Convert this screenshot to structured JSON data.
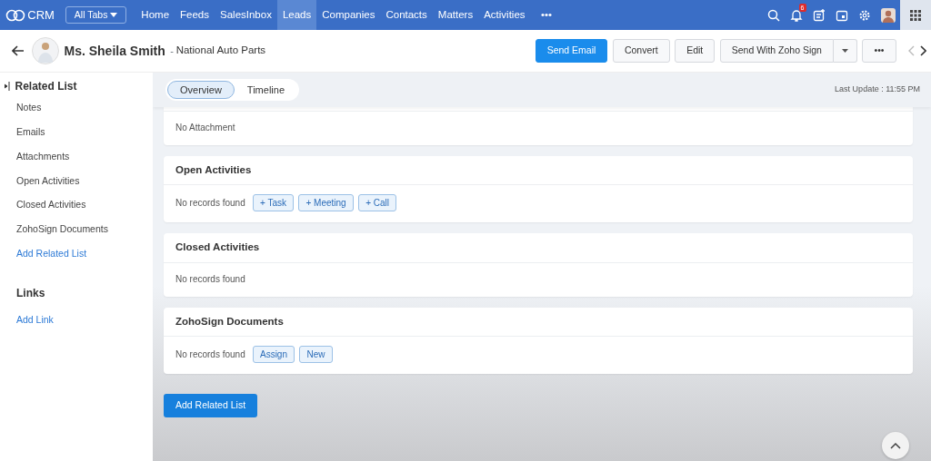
{
  "topbar": {
    "logo": "CRM",
    "all_tabs": "All Tabs",
    "tabs": [
      {
        "label": "Home",
        "selected": false
      },
      {
        "label": "Feeds",
        "selected": false
      },
      {
        "label": "SalesInbox",
        "selected": false
      },
      {
        "label": "Leads",
        "selected": true
      },
      {
        "label": "Companies",
        "selected": false
      },
      {
        "label": "Contacts",
        "selected": false
      },
      {
        "label": "Matters",
        "selected": false
      },
      {
        "label": "Activities",
        "selected": false
      }
    ],
    "more": "•••",
    "notification_count": "6"
  },
  "record": {
    "name": "Ms. Sheila Smith",
    "separator": "-",
    "company": "National Auto Parts",
    "actions": [
      {
        "label": "Send Email",
        "kind": "primary"
      },
      {
        "label": "Convert",
        "kind": "default"
      },
      {
        "label": "Edit",
        "kind": "default"
      },
      {
        "label": "Send With Zoho Sign",
        "kind": "split"
      },
      {
        "label": "•••",
        "kind": "default"
      }
    ]
  },
  "sidebar": {
    "title": "Related List",
    "items": [
      "Notes",
      "Emails",
      "Attachments",
      "Open Activities",
      "Closed Activities",
      "ZohoSign Documents"
    ],
    "add_link": "Add Related List",
    "links_title": "Links",
    "links_add": "Add Link"
  },
  "view_tabs": [
    {
      "label": "Overview",
      "selected": true
    },
    {
      "label": "Timeline",
      "selected": false
    }
  ],
  "last_update": "Last Update : 11:55 PM",
  "sections": [
    {
      "message": "No Attachment"
    },
    {
      "title": "Open Activities",
      "message": "No records found",
      "actions": [
        "+ Task",
        "+ Meeting",
        "+ Call"
      ]
    },
    {
      "title": "Closed Activities",
      "message": "No records found"
    },
    {
      "title": "ZohoSign Documents",
      "message": "No records found",
      "actions": [
        "Assign",
        "New"
      ]
    }
  ],
  "add_related_button": "Add Related List"
}
